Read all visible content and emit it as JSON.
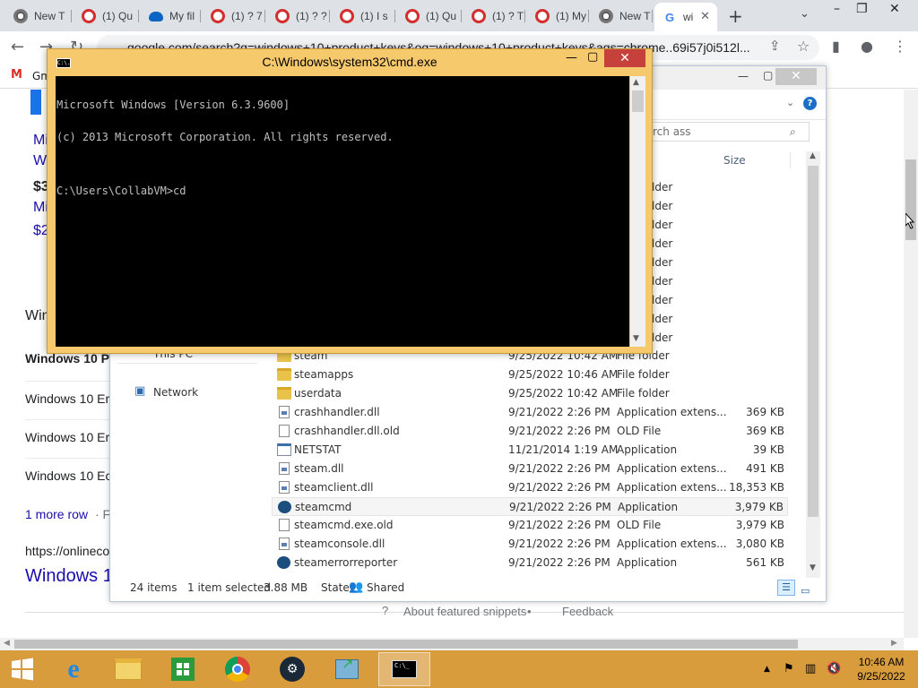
{
  "browser": {
    "tabs": [
      {
        "label": "New T",
        "icon": "chrome-icon"
      },
      {
        "label": "(1) Qu",
        "icon": "quora-icon"
      },
      {
        "label": "My fil",
        "icon": "onedrive-icon"
      },
      {
        "label": "(1) ? 7",
        "icon": "quora-icon"
      },
      {
        "label": "(1) ? ?",
        "icon": "quora-icon"
      },
      {
        "label": "(1) I s",
        "icon": "quora-icon"
      },
      {
        "label": "(1) Qu",
        "icon": "quora-icon"
      },
      {
        "label": "(1) ? T",
        "icon": "quora-icon"
      },
      {
        "label": "(1) My",
        "icon": "quora-icon"
      },
      {
        "label": "New T",
        "icon": "chrome-icon"
      },
      {
        "label": "wi",
        "icon": "google-icon",
        "active": true
      }
    ],
    "url": "google.com/search?q=windows+10+product+keys&oq=windows+10+product+keys&aqs=chrome..69i57j0i512l...",
    "bookmark_first": "Gm",
    "page": {
      "snippet_lines": [
        "Mi",
        "W",
        "$3",
        "Mi",
        "$2"
      ],
      "win_heading": "Win",
      "rows": [
        "Windows 10 P",
        "Windows 10 Er",
        "Windows 10 Er",
        "Windows 10 Ec"
      ],
      "more_rows": "1 more row",
      "more_sep": "· F",
      "source_url": "https://onlineco",
      "result_title": "Windows 1",
      "about_snippets": "About featured snippets",
      "bullet": "•",
      "feedback": "Feedback"
    }
  },
  "explorer": {
    "search_placeholder": "rch ass",
    "col_size": "Size",
    "partial_types": [
      "lder",
      "lder",
      "lder",
      "lder",
      "lder",
      "lder",
      "lder",
      "lder",
      "lder"
    ],
    "nav": {
      "this_pc": "This PC",
      "network": "Network"
    },
    "files": [
      {
        "name": "steam",
        "date": "9/25/2022 10:42 AM",
        "type": "File folder",
        "size": "",
        "icon": "folder"
      },
      {
        "name": "steamapps",
        "date": "9/25/2022 10:46 AM",
        "type": "File folder",
        "size": "",
        "icon": "folder"
      },
      {
        "name": "userdata",
        "date": "9/25/2022 10:42 AM",
        "type": "File folder",
        "size": "",
        "icon": "folder"
      },
      {
        "name": "crashhandler.dll",
        "date": "9/21/2022 2:26 PM",
        "type": "Application extens...",
        "size": "369 KB",
        "icon": "dll"
      },
      {
        "name": "crashhandler.dll.old",
        "date": "9/21/2022 2:26 PM",
        "type": "OLD File",
        "size": "369 KB",
        "icon": "file"
      },
      {
        "name": "NETSTAT",
        "date": "11/21/2014 1:19 AM",
        "type": "Application",
        "size": "39 KB",
        "icon": "app"
      },
      {
        "name": "steam.dll",
        "date": "9/21/2022 2:26 PM",
        "type": "Application extens...",
        "size": "491 KB",
        "icon": "dll"
      },
      {
        "name": "steamclient.dll",
        "date": "9/21/2022 2:26 PM",
        "type": "Application extens...",
        "size": "18,353 KB",
        "icon": "dll"
      },
      {
        "name": "steamcmd",
        "date": "9/21/2022 2:26 PM",
        "type": "Application",
        "size": "3,979 KB",
        "icon": "steam",
        "selected": true
      },
      {
        "name": "steamcmd.exe.old",
        "date": "9/21/2022 2:26 PM",
        "type": "OLD File",
        "size": "3,979 KB",
        "icon": "file"
      },
      {
        "name": "steamconsole.dll",
        "date": "9/21/2022 2:26 PM",
        "type": "Application extens...",
        "size": "3,080 KB",
        "icon": "dll"
      },
      {
        "name": "steamerrorreporter",
        "date": "9/21/2022 2:26 PM",
        "type": "Application",
        "size": "561 KB",
        "icon": "steam"
      }
    ],
    "status": {
      "items": "24 items",
      "selected": "1 item selected",
      "size": "3.88 MB",
      "state_label": "State:",
      "state": "Shared"
    }
  },
  "cmd": {
    "title": "C:\\Windows\\system32\\cmd.exe",
    "icon_text": "C:\\.",
    "lines": [
      "Microsoft Windows [Version 6.3.9600]",
      "(c) 2013 Microsoft Corporation. All rights reserved.",
      "",
      "C:\\Users\\CollabVM>cd"
    ]
  },
  "taskbar": {
    "apps": [
      "start",
      "internet-explorer",
      "file-explorer",
      "store",
      "chrome",
      "steam",
      "app-installer",
      "cmd"
    ],
    "time": "10:46 AM",
    "date": "9/25/2022"
  }
}
